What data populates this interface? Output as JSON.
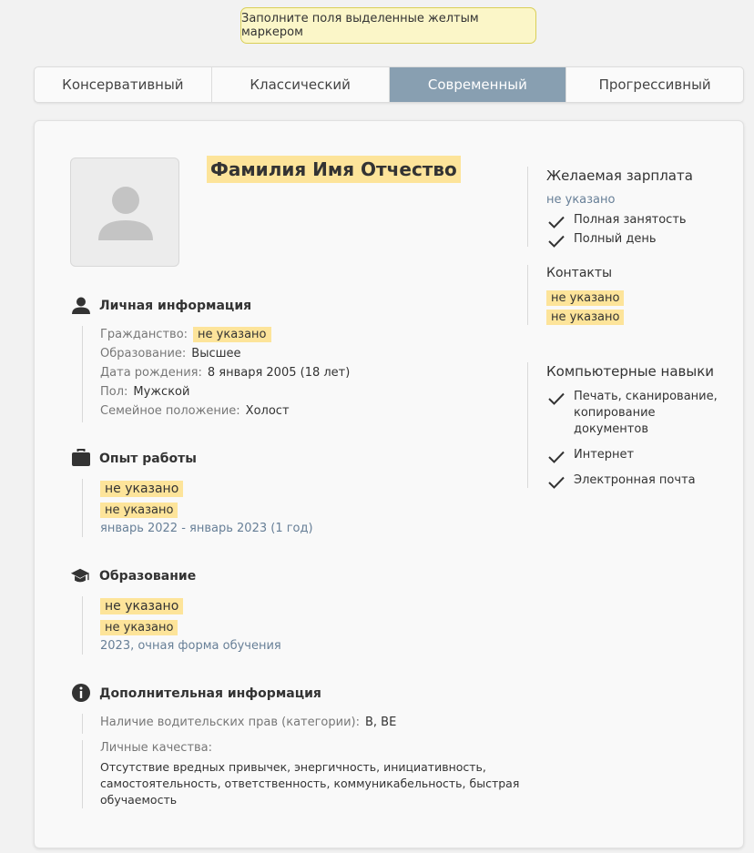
{
  "notice": "Заполните поля выделенные желтым маркером",
  "tabs": [
    "Консервативный",
    "Классический",
    "Современный",
    "Прогрессивный"
  ],
  "name": "Фамилия Имя Отчество",
  "personal": {
    "title": "Личная информация",
    "rows": [
      {
        "label": "Гражданство:",
        "value": "не указано"
      },
      {
        "label": "Образование:",
        "value": "Высшее"
      },
      {
        "label": "Дата рождения:",
        "value": "8 января 2005 (18 лет)"
      },
      {
        "label": "Пол:",
        "value": "Мужской"
      },
      {
        "label": "Семейное положение:",
        "value": "Холост"
      }
    ]
  },
  "work": {
    "title": "Опыт работы",
    "position": "не указано",
    "company": "не указано",
    "period": "январь 2022 - январь 2023 (1 год)"
  },
  "education": {
    "title": "Образование",
    "institution": "не указано",
    "specialty": "не указано",
    "details": "2023, очная форма обучения"
  },
  "extra": {
    "title": "Дополнительная информация",
    "license_label": "Наличие водительских прав (категории):",
    "license_value": "B, BE",
    "qualities_label": "Личные качества:",
    "qualities_lines": [
      "Отсутствие вредных привычек, энергичность, инициативность,",
      "самостоятельность, ответственность, коммуникабельность, быстрая",
      "обучаемость"
    ]
  },
  "salary": {
    "title": "Желаемая зарплата",
    "value": "не указано",
    "items": [
      "Полная занятость",
      "Полный день"
    ]
  },
  "contacts": {
    "title": "Контакты",
    "items": [
      "не указано",
      "не указано"
    ]
  },
  "skills": {
    "title": "Компьютерные навыки",
    "item1_lines": [
      "Печать, сканирование,",
      "копирование",
      "документов"
    ],
    "item2": "Интернет",
    "item3": "Электронная почта"
  },
  "colors": {
    "active_tab": "#889fb1",
    "highlight": "#fde49a",
    "notice_bg": "#fbf6c8",
    "meta_text": "#677f97"
  }
}
